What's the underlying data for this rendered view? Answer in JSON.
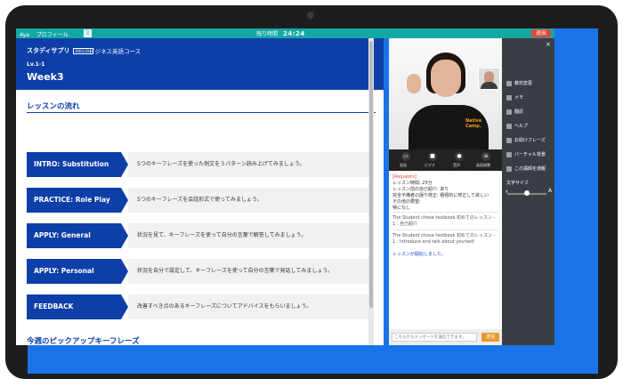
{
  "topbar": {
    "user": "Aya",
    "info1": "プロフィール",
    "lang_icon": "文",
    "timer_label": "残り時間",
    "timer_value": "24:24",
    "end_label": "退出"
  },
  "header": {
    "brand": "スタディサプリ",
    "brand_tag": "ENGLISH",
    "course": "ビジネス英語コース",
    "level": "Lv.1-1",
    "week": "Week3"
  },
  "lesson_flow": {
    "title": "レッスンの流れ",
    "steps": [
      {
        "label": "INTRO: Substitution",
        "desc": "5つのキーフレーズを使った例文を３パターン読み上げてみましょう。"
      },
      {
        "label": "PRACTICE: Role Play",
        "desc": "5つのキーフレーズを会話形式で使ってみましょう。"
      },
      {
        "label": "APPLY: General",
        "desc": "状況を見て、キーフレーズを使って自分の言葉で解答してみましょう。"
      },
      {
        "label": "APPLY: Personal",
        "desc": "状況を自分で設定して、キーフレーズを使って自分の言葉で発話してみましょう。"
      },
      {
        "label": "FEEDBACK",
        "desc": "改善すべき点のあるキーフレーズについてアドバイスをもらいましょう。"
      }
    ]
  },
  "pickup": {
    "title": "今週のピックアップキーフレーズ"
  },
  "video": {
    "logo": "Native\nCamp.",
    "controls": [
      "画面",
      "ビデオ",
      "音声",
      "画面調整"
    ]
  },
  "chat": {
    "request_label": "[Requests]",
    "lines": [
      {
        "text": "レッスン時間: 25分",
        "highlight": ""
      },
      {
        "text": "レッスン前の自己紹介: あり",
        "highlight": ""
      },
      {
        "text": "完全不備者の誤り修正: 積極的に修正して欲しい",
        "highlight": ""
      },
      {
        "text": "その他の要望:",
        "highlight": ""
      },
      {
        "text": "特になし",
        "highlight": ""
      }
    ],
    "sys1": "The Student chose textbook 初めてのレッスン - 1 : 自己紹介",
    "sys2": "The Student chose textbook 初めてのレッスン - 1 : Introduce and talk about yourself",
    "started": "レッスンが開始しました。",
    "placeholder": "こちらからメッセージを送信できます。",
    "send_label": "送信"
  },
  "side": {
    "items": [
      "教材変更",
      "メモ",
      "翻訳",
      "ヘルプ",
      "お助けフレーズ",
      "バーチャル背景",
      "この講師を通報"
    ],
    "font_label": "文字サイズ",
    "small_a": "A",
    "big_a": "A"
  }
}
